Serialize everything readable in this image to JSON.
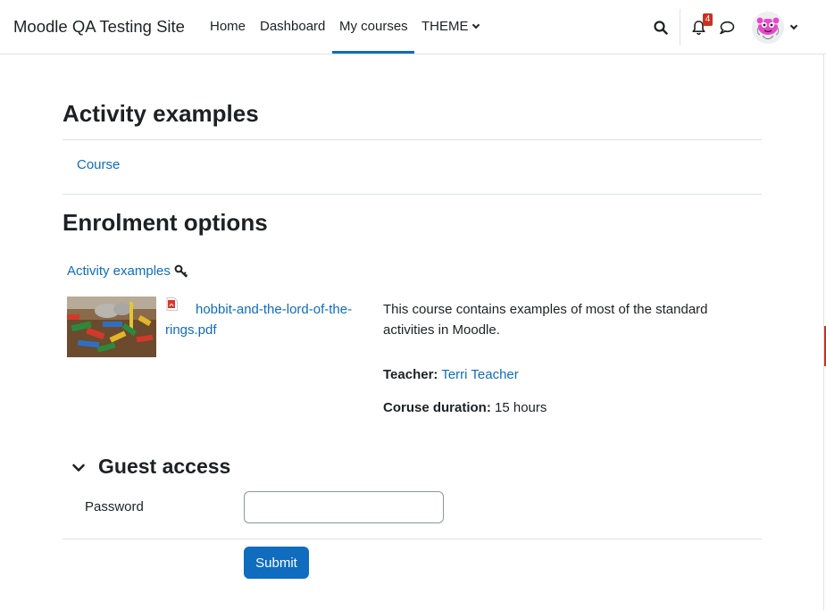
{
  "navbar": {
    "brand": "Moodle QA Testing Site",
    "items": [
      {
        "label": "Home"
      },
      {
        "label": "Dashboard"
      },
      {
        "label": "My courses",
        "active": true
      },
      {
        "label": "THEME",
        "dropdown": true
      }
    ],
    "search_icon": "search-icon",
    "notifications_icon": "bell-icon",
    "notifications_count": "4",
    "messages_icon": "chat-bubble-icon",
    "user_menu_icon": "chevron-down-icon"
  },
  "page": {
    "title": "Activity examples",
    "secondary_nav": {
      "label": "Course"
    },
    "heading": "Enrolment options"
  },
  "course": {
    "name": "Activity examples",
    "enrol_icon": "key-icon",
    "file_name": "hobbit-and-the-lord-of-the-rings.pdf",
    "file_icon": "pdf-icon",
    "summary": "This course contains examples of most of the standard activities in Moodle.",
    "contact_label": "Teacher:",
    "contact_name": "Terri Teacher",
    "duration_label": "Coruse duration:",
    "duration_value": "15 hours"
  },
  "guest_access": {
    "title": "Guest access",
    "toggle_icon": "chevron-down-icon",
    "password_label": "Password",
    "password_value": "",
    "submit_label": "Submit"
  },
  "colors": {
    "primary": "#0f6cbf",
    "text": "#1d2125",
    "badge": "#ca3120",
    "border": "#dee2e6"
  }
}
